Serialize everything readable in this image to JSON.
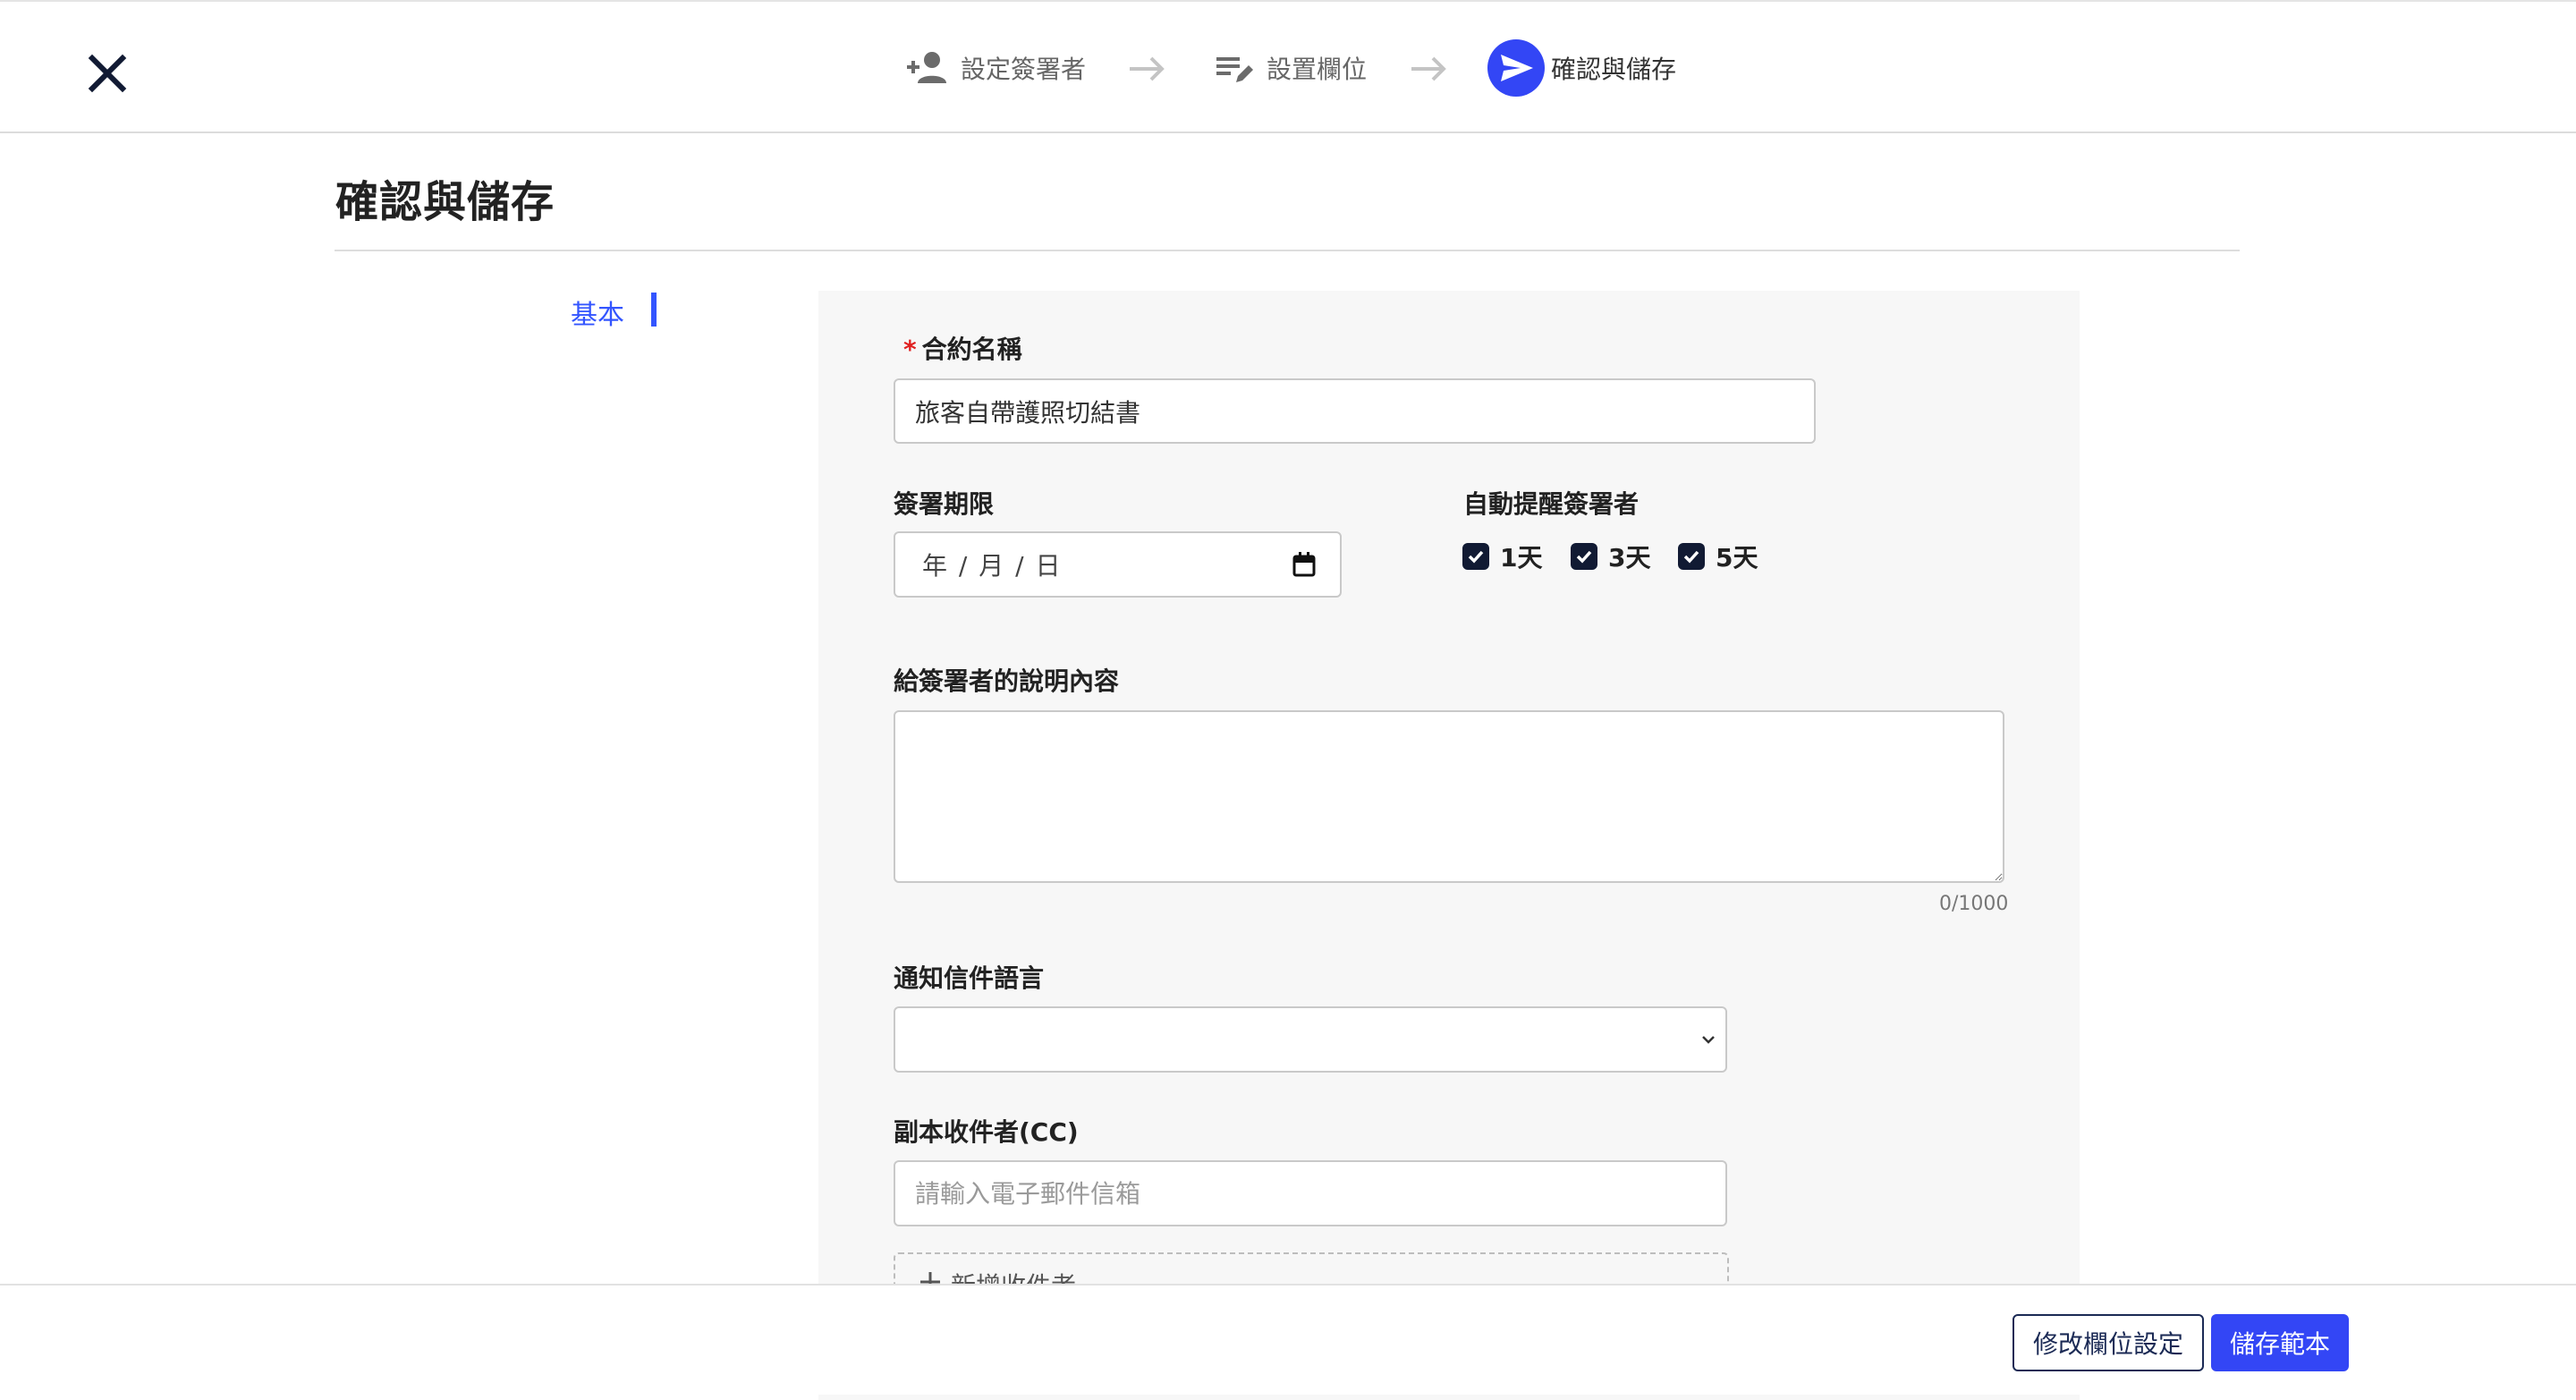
{
  "steps": [
    {
      "label": "設定簽署者",
      "icon": "person-add-icon",
      "state": "done"
    },
    {
      "label": "設置欄位",
      "icon": "edit-list-icon",
      "state": "done"
    },
    {
      "label": "確認與儲存",
      "icon": "send-icon",
      "state": "active"
    }
  ],
  "page": {
    "title": "確認與儲存"
  },
  "side_nav": {
    "items": [
      {
        "label": "基本",
        "active": true
      }
    ]
  },
  "form": {
    "contract_name": {
      "label": "合約名稱",
      "required_mark": "*",
      "value": "旅客自帶護照切結書"
    },
    "deadline": {
      "label": "簽署期限",
      "display": "年 / 月 / 日"
    },
    "reminder": {
      "label": "自動提醒簽署者",
      "options": [
        {
          "label": "1天",
          "checked": true
        },
        {
          "label": "3天",
          "checked": true
        },
        {
          "label": "5天",
          "checked": true
        }
      ]
    },
    "description": {
      "label": "給簽署者的說明內容",
      "value": "",
      "counter": "0/1000"
    },
    "language": {
      "label": "通知信件語言",
      "value": ""
    },
    "cc": {
      "label": "副本收件者(CC)",
      "placeholder": "請輸入電子郵件信箱",
      "add_label": "新增收件者"
    }
  },
  "footer": {
    "edit_fields_label": "修改欄位設定",
    "save_template_label": "儲存範本"
  },
  "colors": {
    "accent": "#3346f5",
    "dark_navy": "#1b2a55",
    "required": "#e02020"
  }
}
